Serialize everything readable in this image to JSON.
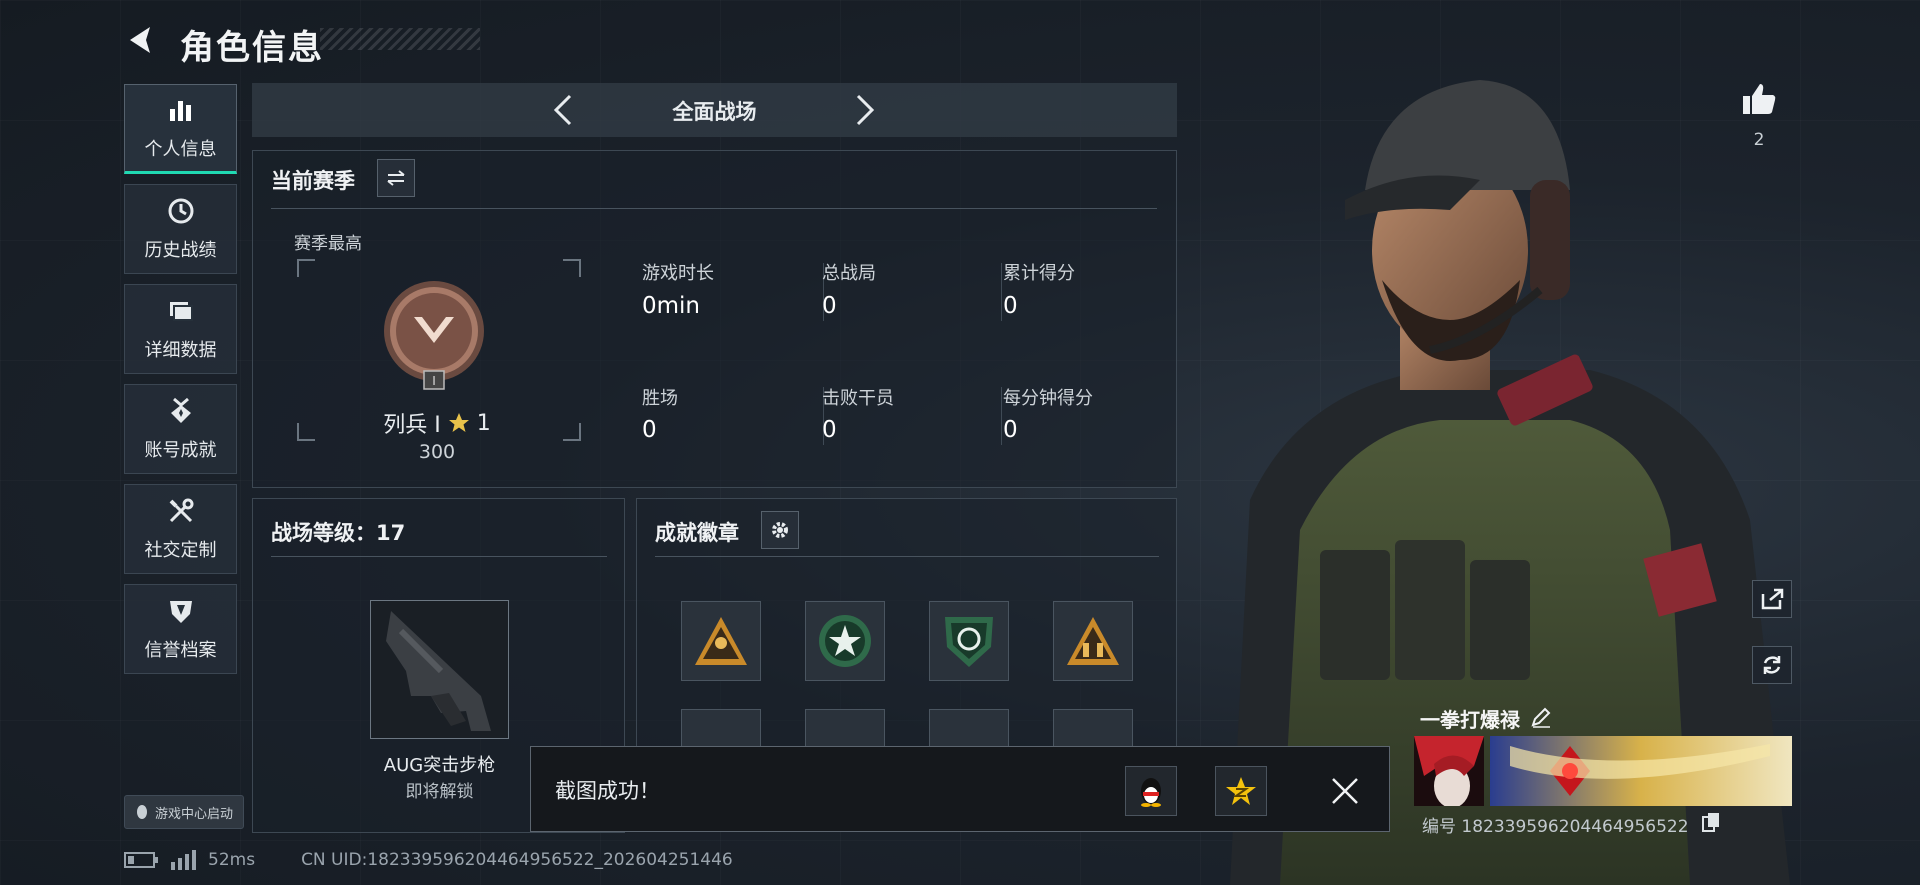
{
  "header": {
    "title": "角色信息"
  },
  "nav": [
    {
      "label": "个人信息",
      "icon": "bar-chart-icon",
      "active": true
    },
    {
      "label": "历史战绩",
      "icon": "clock-icon",
      "active": false
    },
    {
      "label": "详细数据",
      "icon": "folder-icon",
      "active": false
    },
    {
      "label": "账号成就",
      "icon": "medal-icon",
      "active": false
    },
    {
      "label": "社交定制",
      "icon": "tools-icon",
      "active": false
    },
    {
      "label": "信誉档案",
      "icon": "shield-icon",
      "active": false
    }
  ],
  "game_center": {
    "label": "游戏中心启动"
  },
  "mode": {
    "title": "全面战场"
  },
  "season": {
    "title": "当前赛季",
    "best_label": "赛季最高",
    "rank_name": "列兵 I",
    "stars": "1",
    "rank_score": "300",
    "rank_tag": "I",
    "stats": [
      {
        "label": "游戏时长",
        "value": "0min"
      },
      {
        "label": "总战局",
        "value": "0"
      },
      {
        "label": "累计得分",
        "value": "0"
      },
      {
        "label": "胜场",
        "value": "0"
      },
      {
        "label": "击败干员",
        "value": "0"
      },
      {
        "label": "每分钟得分",
        "value": "0"
      }
    ]
  },
  "battlefield_level": {
    "title": "战场等级：17",
    "weapon_name": "AUG突击步枪",
    "weapon_status": "即将解锁"
  },
  "achievements": {
    "title": "成就徽章",
    "badges": [
      "triangle-soldier-badge",
      "star-wreath-badge",
      "shield-arrows-badge",
      "triangle-squad-badge",
      "empty",
      "empty",
      "empty",
      "empty"
    ]
  },
  "toast": {
    "text": "截图成功！"
  },
  "status": {
    "latency": "52ms",
    "uid": "CN UID:18233959620446495652​2_202604251446"
  },
  "likes": {
    "count": "2"
  },
  "player": {
    "name": "一拳打爆禄",
    "id": "编号 182339596204464956522"
  },
  "colors": {
    "accent": "#20d9b2",
    "gold": "#e8c24a",
    "toast_bg": "#15181c"
  }
}
